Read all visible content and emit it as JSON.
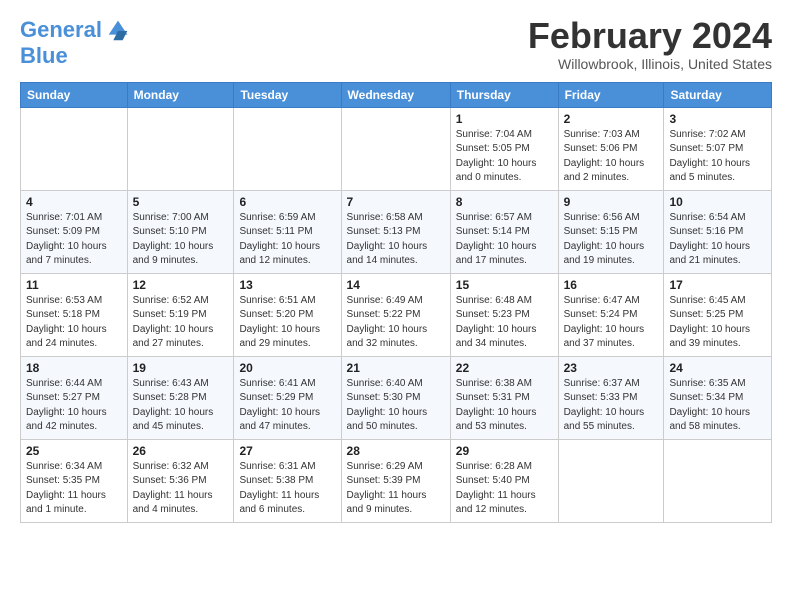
{
  "header": {
    "logo_line1": "General",
    "logo_line2": "Blue",
    "month": "February 2024",
    "location": "Willowbrook, Illinois, United States"
  },
  "weekdays": [
    "Sunday",
    "Monday",
    "Tuesday",
    "Wednesday",
    "Thursday",
    "Friday",
    "Saturday"
  ],
  "weeks": [
    [
      {
        "day": "",
        "info": ""
      },
      {
        "day": "",
        "info": ""
      },
      {
        "day": "",
        "info": ""
      },
      {
        "day": "",
        "info": ""
      },
      {
        "day": "1",
        "info": "Sunrise: 7:04 AM\nSunset: 5:05 PM\nDaylight: 10 hours\nand 0 minutes."
      },
      {
        "day": "2",
        "info": "Sunrise: 7:03 AM\nSunset: 5:06 PM\nDaylight: 10 hours\nand 2 minutes."
      },
      {
        "day": "3",
        "info": "Sunrise: 7:02 AM\nSunset: 5:07 PM\nDaylight: 10 hours\nand 5 minutes."
      }
    ],
    [
      {
        "day": "4",
        "info": "Sunrise: 7:01 AM\nSunset: 5:09 PM\nDaylight: 10 hours\nand 7 minutes."
      },
      {
        "day": "5",
        "info": "Sunrise: 7:00 AM\nSunset: 5:10 PM\nDaylight: 10 hours\nand 9 minutes."
      },
      {
        "day": "6",
        "info": "Sunrise: 6:59 AM\nSunset: 5:11 PM\nDaylight: 10 hours\nand 12 minutes."
      },
      {
        "day": "7",
        "info": "Sunrise: 6:58 AM\nSunset: 5:13 PM\nDaylight: 10 hours\nand 14 minutes."
      },
      {
        "day": "8",
        "info": "Sunrise: 6:57 AM\nSunset: 5:14 PM\nDaylight: 10 hours\nand 17 minutes."
      },
      {
        "day": "9",
        "info": "Sunrise: 6:56 AM\nSunset: 5:15 PM\nDaylight: 10 hours\nand 19 minutes."
      },
      {
        "day": "10",
        "info": "Sunrise: 6:54 AM\nSunset: 5:16 PM\nDaylight: 10 hours\nand 21 minutes."
      }
    ],
    [
      {
        "day": "11",
        "info": "Sunrise: 6:53 AM\nSunset: 5:18 PM\nDaylight: 10 hours\nand 24 minutes."
      },
      {
        "day": "12",
        "info": "Sunrise: 6:52 AM\nSunset: 5:19 PM\nDaylight: 10 hours\nand 27 minutes."
      },
      {
        "day": "13",
        "info": "Sunrise: 6:51 AM\nSunset: 5:20 PM\nDaylight: 10 hours\nand 29 minutes."
      },
      {
        "day": "14",
        "info": "Sunrise: 6:49 AM\nSunset: 5:22 PM\nDaylight: 10 hours\nand 32 minutes."
      },
      {
        "day": "15",
        "info": "Sunrise: 6:48 AM\nSunset: 5:23 PM\nDaylight: 10 hours\nand 34 minutes."
      },
      {
        "day": "16",
        "info": "Sunrise: 6:47 AM\nSunset: 5:24 PM\nDaylight: 10 hours\nand 37 minutes."
      },
      {
        "day": "17",
        "info": "Sunrise: 6:45 AM\nSunset: 5:25 PM\nDaylight: 10 hours\nand 39 minutes."
      }
    ],
    [
      {
        "day": "18",
        "info": "Sunrise: 6:44 AM\nSunset: 5:27 PM\nDaylight: 10 hours\nand 42 minutes."
      },
      {
        "day": "19",
        "info": "Sunrise: 6:43 AM\nSunset: 5:28 PM\nDaylight: 10 hours\nand 45 minutes."
      },
      {
        "day": "20",
        "info": "Sunrise: 6:41 AM\nSunset: 5:29 PM\nDaylight: 10 hours\nand 47 minutes."
      },
      {
        "day": "21",
        "info": "Sunrise: 6:40 AM\nSunset: 5:30 PM\nDaylight: 10 hours\nand 50 minutes."
      },
      {
        "day": "22",
        "info": "Sunrise: 6:38 AM\nSunset: 5:31 PM\nDaylight: 10 hours\nand 53 minutes."
      },
      {
        "day": "23",
        "info": "Sunrise: 6:37 AM\nSunset: 5:33 PM\nDaylight: 10 hours\nand 55 minutes."
      },
      {
        "day": "24",
        "info": "Sunrise: 6:35 AM\nSunset: 5:34 PM\nDaylight: 10 hours\nand 58 minutes."
      }
    ],
    [
      {
        "day": "25",
        "info": "Sunrise: 6:34 AM\nSunset: 5:35 PM\nDaylight: 11 hours\nand 1 minute."
      },
      {
        "day": "26",
        "info": "Sunrise: 6:32 AM\nSunset: 5:36 PM\nDaylight: 11 hours\nand 4 minutes."
      },
      {
        "day": "27",
        "info": "Sunrise: 6:31 AM\nSunset: 5:38 PM\nDaylight: 11 hours\nand 6 minutes."
      },
      {
        "day": "28",
        "info": "Sunrise: 6:29 AM\nSunset: 5:39 PM\nDaylight: 11 hours\nand 9 minutes."
      },
      {
        "day": "29",
        "info": "Sunrise: 6:28 AM\nSunset: 5:40 PM\nDaylight: 11 hours\nand 12 minutes."
      },
      {
        "day": "",
        "info": ""
      },
      {
        "day": "",
        "info": ""
      }
    ]
  ]
}
